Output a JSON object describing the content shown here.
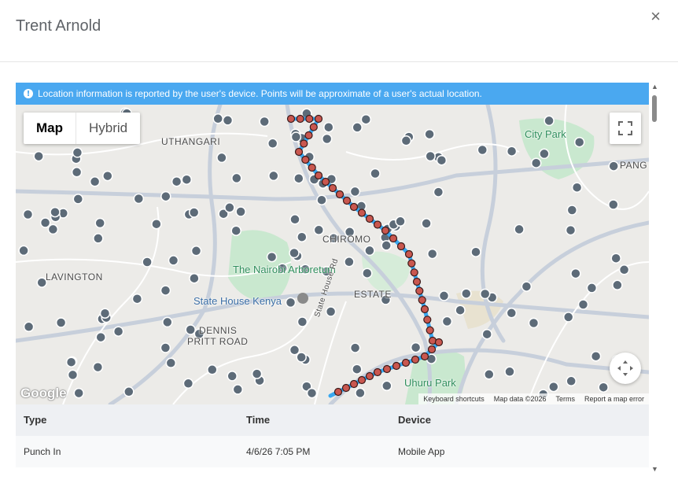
{
  "dialog": {
    "title": "Trent Arnold",
    "close_label": "×"
  },
  "banner": {
    "icon": "info-icon",
    "text": "Location information is reported by the user's device. Points will be approximate of a user's actual location."
  },
  "map": {
    "type_buttons": [
      {
        "label": "Map",
        "active": true
      },
      {
        "label": "Hybrid",
        "active": false
      }
    ],
    "labels": {
      "kuthangari": "UTHANGARI",
      "city_park": "City Park",
      "pang": "PANG",
      "chiromo": "CHIROMO",
      "lavington": "LAVINGTON",
      "arboretum": "The Nairobi Arboretum",
      "state_house_kenya": "State House Kenya",
      "estate": "ESTATE",
      "state_house_rd": "State House Rd",
      "dennis": "DENNIS",
      "pritt_road": "PRITT ROAD",
      "uhuru_park": "Uhuru Park"
    },
    "google_logo": "Google",
    "attribution": {
      "shortcuts": "Keyboard shortcuts",
      "data": "Map data ©2026",
      "terms": "Terms",
      "report": "Report a map error"
    },
    "colors": {
      "route": "#3aa8f0",
      "point_fill": "#c9574f",
      "point_stroke": "#3a1a1a",
      "park": "#c9e8cf",
      "road": "#ffffff"
    }
  },
  "table": {
    "headers": {
      "type": "Type",
      "time": "Time",
      "device": "Device"
    },
    "rows": [
      {
        "type": "Punch In",
        "time": "4/6/26 7:05 PM",
        "device": "Mobile App"
      }
    ]
  }
}
